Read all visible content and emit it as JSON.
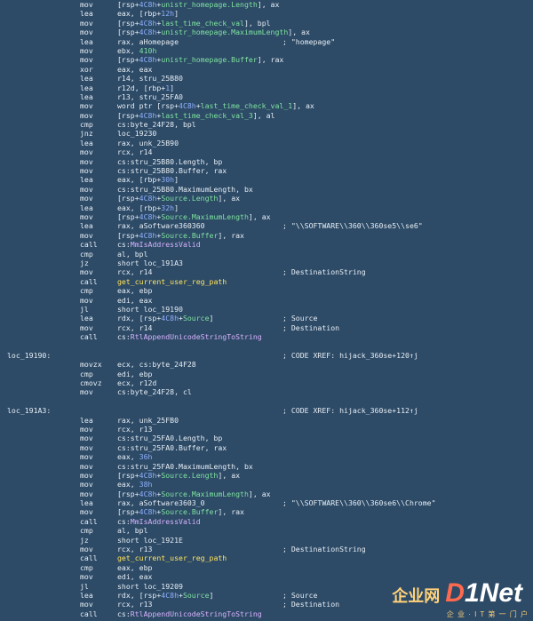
{
  "disasm": [
    {
      "label": "",
      "mnem": "mov",
      "ops": [
        [
          "",
          "[rsp+"
        ],
        [
          "k",
          "4C8h"
        ],
        [
          "",
          "+"
        ],
        [
          "c",
          "unistr_homepage.Length"
        ],
        [
          "",
          "], ax"
        ]
      ],
      "comment": ""
    },
    {
      "label": "",
      "mnem": "lea",
      "ops": [
        [
          "",
          "eax, [rbp+"
        ],
        [
          "k",
          "12h"
        ],
        [
          "",
          "]"
        ]
      ],
      "comment": ""
    },
    {
      "label": "",
      "mnem": "mov",
      "ops": [
        [
          "",
          "[rsp+"
        ],
        [
          "k",
          "4C8h"
        ],
        [
          "",
          "+"
        ],
        [
          "c",
          "last_time_check_val"
        ],
        [
          "",
          "], bpl"
        ]
      ],
      "comment": ""
    },
    {
      "label": "",
      "mnem": "mov",
      "ops": [
        [
          "",
          "[rsp+"
        ],
        [
          "k",
          "4C8h"
        ],
        [
          "",
          "+"
        ],
        [
          "c",
          "unistr_homepage.MaximumLength"
        ],
        [
          "",
          "], ax"
        ]
      ],
      "comment": ""
    },
    {
      "label": "",
      "mnem": "lea",
      "ops": [
        [
          "",
          "rax, aHomepage"
        ]
      ],
      "comment": "; \"homepage\""
    },
    {
      "label": "",
      "mnem": "mov",
      "ops": [
        [
          "",
          "ebx, "
        ],
        [
          "c",
          "410h"
        ]
      ],
      "comment": ""
    },
    {
      "label": "",
      "mnem": "mov",
      "ops": [
        [
          "",
          "[rsp+"
        ],
        [
          "k",
          "4C8h"
        ],
        [
          "",
          "+"
        ],
        [
          "c",
          "unistr_homepage.Buffer"
        ],
        [
          "",
          "], rax"
        ]
      ],
      "comment": ""
    },
    {
      "label": "",
      "mnem": "xor",
      "ops": [
        [
          "",
          "eax, eax"
        ]
      ],
      "comment": ""
    },
    {
      "label": "",
      "mnem": "lea",
      "ops": [
        [
          "",
          "r14, stru_25B80"
        ]
      ],
      "comment": ""
    },
    {
      "label": "",
      "mnem": "lea",
      "ops": [
        [
          "",
          "r12d, [rbp+"
        ],
        [
          "k",
          "1"
        ],
        [
          "",
          "]"
        ]
      ],
      "comment": ""
    },
    {
      "label": "",
      "mnem": "lea",
      "ops": [
        [
          "",
          "r13, stru_25FA0"
        ]
      ],
      "comment": ""
    },
    {
      "label": "",
      "mnem": "mov",
      "ops": [
        [
          "",
          "word ptr [rsp+"
        ],
        [
          "k",
          "4C8h"
        ],
        [
          "",
          "+"
        ],
        [
          "c",
          "last_time_check_val_1"
        ],
        [
          "",
          "], ax"
        ]
      ],
      "comment": ""
    },
    {
      "label": "",
      "mnem": "mov",
      "ops": [
        [
          "",
          "[rsp+"
        ],
        [
          "k",
          "4C8h"
        ],
        [
          "",
          "+"
        ],
        [
          "c",
          "last_time_check_val_3"
        ],
        [
          "",
          "], al"
        ]
      ],
      "comment": ""
    },
    {
      "label": "",
      "mnem": "cmp",
      "ops": [
        [
          "",
          "cs:byte_24F28, bpl"
        ]
      ],
      "comment": ""
    },
    {
      "label": "",
      "mnem": "jnz",
      "ops": [
        [
          "",
          "loc_19230"
        ]
      ],
      "comment": ""
    },
    {
      "label": "",
      "mnem": "lea",
      "ops": [
        [
          "",
          "rax, unk_25B90"
        ]
      ],
      "comment": ""
    },
    {
      "label": "",
      "mnem": "mov",
      "ops": [
        [
          "",
          "rcx, r14"
        ]
      ],
      "comment": ""
    },
    {
      "label": "",
      "mnem": "mov",
      "ops": [
        [
          "",
          "cs:stru_25B80.Length, bp"
        ]
      ],
      "comment": ""
    },
    {
      "label": "",
      "mnem": "mov",
      "ops": [
        [
          "",
          "cs:stru_25B80.Buffer, rax"
        ]
      ],
      "comment": ""
    },
    {
      "label": "",
      "mnem": "lea",
      "ops": [
        [
          "",
          "eax, [rbp+"
        ],
        [
          "k",
          "30h"
        ],
        [
          "",
          "]"
        ]
      ],
      "comment": ""
    },
    {
      "label": "",
      "mnem": "mov",
      "ops": [
        [
          "",
          "cs:stru_25B80.MaximumLength, bx"
        ]
      ],
      "comment": ""
    },
    {
      "label": "",
      "mnem": "mov",
      "ops": [
        [
          "",
          "[rsp+"
        ],
        [
          "k",
          "4C8h"
        ],
        [
          "",
          "+"
        ],
        [
          "c",
          "Source.Length"
        ],
        [
          "",
          "], ax"
        ]
      ],
      "comment": ""
    },
    {
      "label": "",
      "mnem": "lea",
      "ops": [
        [
          "",
          "eax, [rbp+"
        ],
        [
          "k",
          "32h"
        ],
        [
          "",
          "]"
        ]
      ],
      "comment": ""
    },
    {
      "label": "",
      "mnem": "mov",
      "ops": [
        [
          "",
          "[rsp+"
        ],
        [
          "k",
          "4C8h"
        ],
        [
          "",
          "+"
        ],
        [
          "c",
          "Source.MaximumLength"
        ],
        [
          "",
          "], ax"
        ]
      ],
      "comment": ""
    },
    {
      "label": "",
      "mnem": "lea",
      "ops": [
        [
          "",
          "rax, aSoftware360360"
        ]
      ],
      "comment": "; \"\\\\SOFTWARE\\\\360\\\\360se5\\\\se6\""
    },
    {
      "label": "",
      "mnem": "mov",
      "ops": [
        [
          "",
          "[rsp+"
        ],
        [
          "k",
          "4C8h"
        ],
        [
          "",
          "+"
        ],
        [
          "c",
          "Source.Buffer"
        ],
        [
          "",
          "], rax"
        ]
      ],
      "comment": ""
    },
    {
      "label": "",
      "mnem": "call",
      "ops": [
        [
          "",
          "cs:"
        ],
        [
          "p",
          "MmIsAddressValid"
        ]
      ],
      "comment": ""
    },
    {
      "label": "",
      "mnem": "cmp",
      "ops": [
        [
          "",
          "al, bpl"
        ]
      ],
      "comment": ""
    },
    {
      "label": "",
      "mnem": "jz",
      "ops": [
        [
          "",
          "short loc_191A3"
        ]
      ],
      "comment": ""
    },
    {
      "label": "",
      "mnem": "mov",
      "ops": [
        [
          "",
          "rcx, r14"
        ]
      ],
      "comment": "; DestinationString"
    },
    {
      "label": "",
      "mnem": "call",
      "ops": [
        [
          "y",
          "get_current_user_reg_path"
        ]
      ],
      "comment": ""
    },
    {
      "label": "",
      "mnem": "cmp",
      "ops": [
        [
          "",
          "eax, ebp"
        ]
      ],
      "comment": ""
    },
    {
      "label": "",
      "mnem": "mov",
      "ops": [
        [
          "",
          "edi, eax"
        ]
      ],
      "comment": ""
    },
    {
      "label": "",
      "mnem": "jl",
      "ops": [
        [
          "",
          "short loc_19190"
        ]
      ],
      "comment": ""
    },
    {
      "label": "",
      "mnem": "lea",
      "ops": [
        [
          "",
          "rdx, [rsp+"
        ],
        [
          "k",
          "4C8h"
        ],
        [
          "",
          "+"
        ],
        [
          "c",
          "Source"
        ],
        [
          "",
          "]"
        ]
      ],
      "comment": "; Source"
    },
    {
      "label": "",
      "mnem": "mov",
      "ops": [
        [
          "",
          "rcx, r14"
        ]
      ],
      "comment": "; Destination"
    },
    {
      "label": "",
      "mnem": "call",
      "ops": [
        [
          "",
          "cs:"
        ],
        [
          "p",
          "RtlAppendUnicodeStringToString"
        ]
      ],
      "comment": ""
    },
    {
      "label": "",
      "mnem": "",
      "ops": [],
      "comment": ""
    },
    {
      "label": "loc_19190:",
      "mnem": "",
      "ops": [],
      "comment": "; CODE XREF: hijack_360se+120↑j"
    },
    {
      "label": "",
      "mnem": "movzx",
      "ops": [
        [
          "",
          "ecx, cs:byte_24F28"
        ]
      ],
      "comment": ""
    },
    {
      "label": "",
      "mnem": "cmp",
      "ops": [
        [
          "",
          "edi, ebp"
        ]
      ],
      "comment": ""
    },
    {
      "label": "",
      "mnem": "cmovz",
      "ops": [
        [
          "",
          "ecx, r12d"
        ]
      ],
      "comment": ""
    },
    {
      "label": "",
      "mnem": "mov",
      "ops": [
        [
          "",
          "cs:byte_24F28, cl"
        ]
      ],
      "comment": ""
    },
    {
      "label": "",
      "mnem": "",
      "ops": [],
      "comment": ""
    },
    {
      "label": "loc_191A3:",
      "mnem": "",
      "ops": [],
      "comment": "; CODE XREF: hijack_360se+112↑j"
    },
    {
      "label": "",
      "mnem": "lea",
      "ops": [
        [
          "",
          "rax, unk_25FB0"
        ]
      ],
      "comment": ""
    },
    {
      "label": "",
      "mnem": "mov",
      "ops": [
        [
          "",
          "rcx, r13"
        ]
      ],
      "comment": ""
    },
    {
      "label": "",
      "mnem": "mov",
      "ops": [
        [
          "",
          "cs:stru_25FA0.Length, bp"
        ]
      ],
      "comment": ""
    },
    {
      "label": "",
      "mnem": "mov",
      "ops": [
        [
          "",
          "cs:stru_25FA0.Buffer, rax"
        ]
      ],
      "comment": ""
    },
    {
      "label": "",
      "mnem": "mov",
      "ops": [
        [
          "",
          "eax, "
        ],
        [
          "k",
          "36h"
        ]
      ],
      "comment": ""
    },
    {
      "label": "",
      "mnem": "mov",
      "ops": [
        [
          "",
          "cs:stru_25FA0.MaximumLength, bx"
        ]
      ],
      "comment": ""
    },
    {
      "label": "",
      "mnem": "mov",
      "ops": [
        [
          "",
          "[rsp+"
        ],
        [
          "k",
          "4C8h"
        ],
        [
          "",
          "+"
        ],
        [
          "c",
          "Source.Length"
        ],
        [
          "",
          "], ax"
        ]
      ],
      "comment": ""
    },
    {
      "label": "",
      "mnem": "mov",
      "ops": [
        [
          "",
          "eax, "
        ],
        [
          "k",
          "38h"
        ]
      ],
      "comment": ""
    },
    {
      "label": "",
      "mnem": "mov",
      "ops": [
        [
          "",
          "[rsp+"
        ],
        [
          "k",
          "4C8h"
        ],
        [
          "",
          "+"
        ],
        [
          "c",
          "Source.MaximumLength"
        ],
        [
          "",
          "], ax"
        ]
      ],
      "comment": ""
    },
    {
      "label": "",
      "mnem": "lea",
      "ops": [
        [
          "",
          "rax, aSoftware3603_0"
        ]
      ],
      "comment": "; \"\\\\SOFTWARE\\\\360\\\\360se6\\\\Chrome\""
    },
    {
      "label": "",
      "mnem": "mov",
      "ops": [
        [
          "",
          "[rsp+"
        ],
        [
          "k",
          "4C8h"
        ],
        [
          "",
          "+"
        ],
        [
          "c",
          "Source.Buffer"
        ],
        [
          "",
          "], rax"
        ]
      ],
      "comment": ""
    },
    {
      "label": "",
      "mnem": "call",
      "ops": [
        [
          "",
          "cs:"
        ],
        [
          "p",
          "MmIsAddressValid"
        ]
      ],
      "comment": ""
    },
    {
      "label": "",
      "mnem": "cmp",
      "ops": [
        [
          "",
          "al, bpl"
        ]
      ],
      "comment": ""
    },
    {
      "label": "",
      "mnem": "jz",
      "ops": [
        [
          "",
          "short loc_1921E"
        ]
      ],
      "comment": ""
    },
    {
      "label": "",
      "mnem": "mov",
      "ops": [
        [
          "",
          "rcx, r13"
        ]
      ],
      "comment": "; DestinationString"
    },
    {
      "label": "",
      "mnem": "call",
      "ops": [
        [
          "y",
          "get_current_user_reg_path"
        ]
      ],
      "comment": ""
    },
    {
      "label": "",
      "mnem": "cmp",
      "ops": [
        [
          "",
          "eax, ebp"
        ]
      ],
      "comment": ""
    },
    {
      "label": "",
      "mnem": "mov",
      "ops": [
        [
          "",
          "edi, eax"
        ]
      ],
      "comment": ""
    },
    {
      "label": "",
      "mnem": "jl",
      "ops": [
        [
          "",
          "short loc_19209"
        ]
      ],
      "comment": ""
    },
    {
      "label": "",
      "mnem": "lea",
      "ops": [
        [
          "",
          "rdx, [rsp+"
        ],
        [
          "k",
          "4C8h"
        ],
        [
          "",
          "+"
        ],
        [
          "c",
          "Source"
        ],
        [
          "",
          "]"
        ]
      ],
      "comment": "; Source"
    },
    {
      "label": "",
      "mnem": "mov",
      "ops": [
        [
          "",
          "rcx, r13"
        ]
      ],
      "comment": "; Destination"
    },
    {
      "label": "",
      "mnem": "call",
      "ops": [
        [
          "",
          "cs:"
        ],
        [
          "p",
          "RtlAppendUnicodeStringToString"
        ]
      ],
      "comment": ""
    }
  ],
  "colors": {
    "background": "#2d4a66",
    "text": "#e6eef5",
    "struct_field": "#7fe3a1",
    "number": "#8fb0ff",
    "function": "#ffe45e",
    "import": "#d8b3ff"
  },
  "watermark": {
    "cn": "企业网",
    "brand_d": "D",
    "brand_rest": "1Net",
    "sub": "企 业 · I T 第 一 门 户"
  }
}
